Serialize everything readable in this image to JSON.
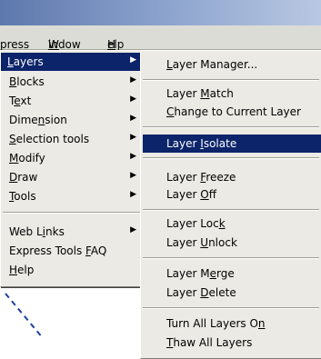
{
  "menubar": {
    "items": [
      {
        "pre": "press",
        "key": "",
        "post": ""
      },
      {
        "pre": "",
        "key": "W",
        "post": "indow"
      },
      {
        "pre": "",
        "key": "H",
        "post": "elp"
      }
    ]
  },
  "express_menu": {
    "items": [
      {
        "pre": "",
        "key": "L",
        "post": "ayers",
        "arrow": "▶"
      },
      {
        "pre": "",
        "key": "B",
        "post": "locks",
        "arrow": "▶"
      },
      {
        "pre": "T",
        "key": "e",
        "post": "xt",
        "arrow": "▶"
      },
      {
        "pre": "Dime",
        "key": "n",
        "post": "sion",
        "arrow": "▶"
      },
      {
        "pre": "",
        "key": "S",
        "post": "election tools",
        "arrow": "▶"
      },
      {
        "pre": "",
        "key": "M",
        "post": "odify",
        "arrow": "▶"
      },
      {
        "pre": "",
        "key": "D",
        "post": "raw",
        "arrow": "▶"
      },
      {
        "pre": "",
        "key": "T",
        "post": "ools",
        "arrow": "▶"
      },
      {
        "pre": "Web L",
        "key": "i",
        "post": "nks",
        "arrow": "▶"
      },
      {
        "pre": "Express Tools ",
        "key": "F",
        "post": "AQ",
        "arrow": ""
      },
      {
        "pre": "",
        "key": "H",
        "post": "elp",
        "arrow": ""
      }
    ]
  },
  "layers_submenu": {
    "items": [
      {
        "pre": "",
        "key": "L",
        "post": "ayer Manager..."
      },
      {
        "pre": "Layer ",
        "key": "M",
        "post": "atch"
      },
      {
        "pre": "",
        "key": "C",
        "post": "hange to Current Layer"
      },
      {
        "pre": "Layer ",
        "key": "I",
        "post": "solate"
      },
      {
        "pre": "Layer ",
        "key": "F",
        "post": "reeze"
      },
      {
        "pre": "Layer ",
        "key": "O",
        "post": "ff"
      },
      {
        "pre": "Layer Loc",
        "key": "k",
        "post": ""
      },
      {
        "pre": "Layer ",
        "key": "U",
        "post": "nlock"
      },
      {
        "pre": "Layer M",
        "key": "e",
        "post": "rge"
      },
      {
        "pre": "Layer ",
        "key": "D",
        "post": "elete"
      },
      {
        "pre": "Turn All Layers O",
        "key": "n",
        "post": ""
      },
      {
        "pre": "",
        "key": "T",
        "post": "haw All Layers"
      }
    ]
  }
}
